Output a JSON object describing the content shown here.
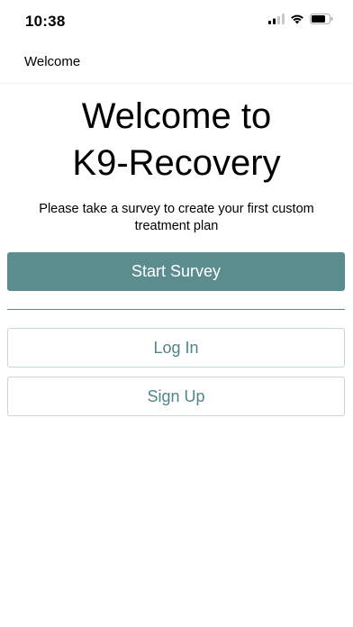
{
  "status_bar": {
    "time": "10:38",
    "icons": [
      "signal-icon",
      "wifi-icon",
      "battery-icon"
    ]
  },
  "nav": {
    "title": "Welcome"
  },
  "main": {
    "title_line1": "Welcome to",
    "title_line2": "K9-Recovery",
    "subtitle": "Please take a survey to create your first custom treatment plan",
    "start_survey_label": "Start Survey",
    "login_label": "Log In",
    "signup_label": "Sign Up"
  },
  "colors": {
    "accent": "#5b8d8f",
    "secondary_text": "#4f8588",
    "secondary_border": "#c9d6d6"
  }
}
